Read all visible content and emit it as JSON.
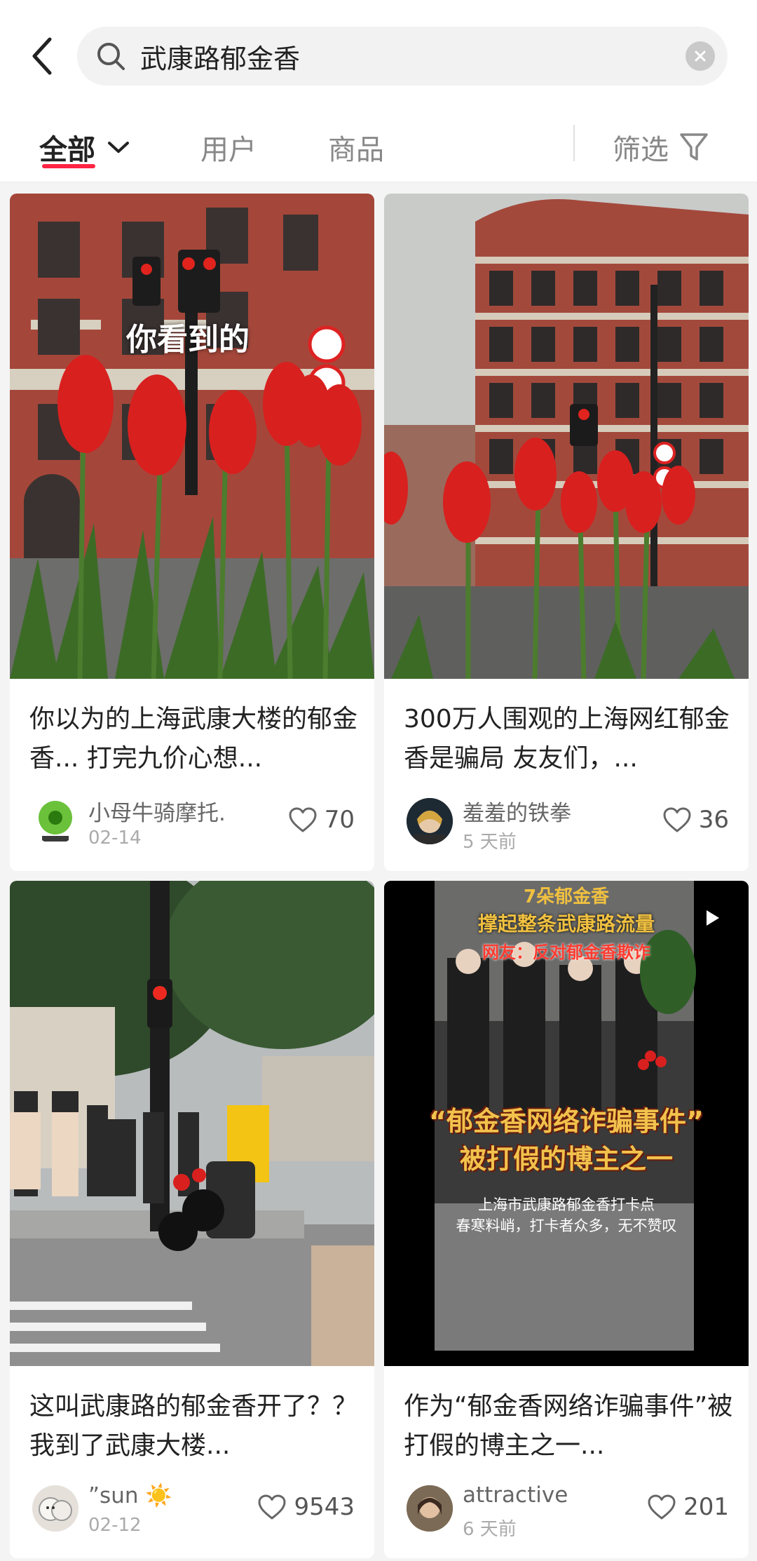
{
  "search": {
    "query": "武康路郁金香"
  },
  "tabs": [
    {
      "label": "全部"
    },
    {
      "label": "用户"
    },
    {
      "label": "商品"
    }
  ],
  "filter": {
    "label": "筛选"
  },
  "cards": [
    {
      "title": "你以为的上海武康大楼的郁金香... 打完九价心想...",
      "overlay": "你看到的",
      "author": "小母牛骑摩托.",
      "date": "02-14",
      "likes": "70"
    },
    {
      "title": "300万人围观的上海网红郁金香是骗局 友友们，...",
      "author": "羞羞的铁拳",
      "date": "5 天前",
      "likes": "36"
    },
    {
      "title": "这叫武康路的郁金香开了？？ 我到了武康大楼...",
      "author": "”sun ☀️",
      "date": "02-12",
      "likes": "9543"
    },
    {
      "title": "作为“郁金香网络诈骗事件”被打假的博主之一...",
      "author": "attractive",
      "date": "6 天前",
      "likes": "201",
      "video_text": {
        "line1": "7朵郁金香",
        "line2": "撑起整条武康路流量",
        "line3": "网友：反对郁金香欺诈",
        "big1": "“郁金香网络诈骗事件”",
        "big2": "被打假的博主之一",
        "sub1": "上海市武康路郁金香打卡点",
        "sub2": "春寒料峭，打卡者众多，无不赞叹"
      }
    }
  ],
  "colors": {
    "accent": "#ff2442",
    "tulip": "#d8201f",
    "brick": "#a4473a"
  }
}
